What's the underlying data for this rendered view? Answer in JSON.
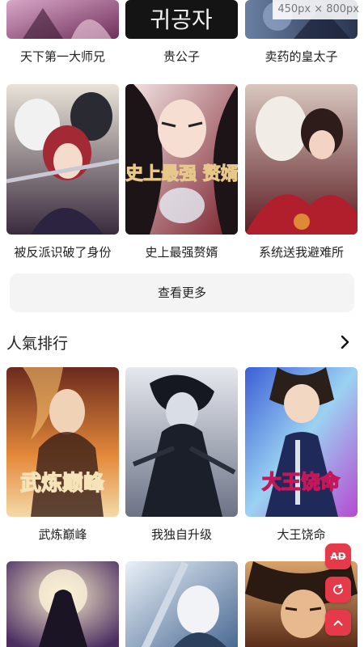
{
  "viewport_badge": "450px × 800px",
  "row_top_titles": [
    "天下第一大师兄",
    "贵公子",
    "卖药的皇太子"
  ],
  "row_top_cover_text": "귀공자",
  "row_second": [
    {
      "title": "被反派识破了身份"
    },
    {
      "title": "史上最强赘婿",
      "cover_text": "史上最强 赘婿"
    },
    {
      "title": "系统送我避难所"
    }
  ],
  "more_button": "查看更多",
  "section": {
    "title": "人氣排行",
    "arrow_icon": "chevron-right-icon"
  },
  "row_popular": [
    {
      "title": "武炼巅峰",
      "cover_text": "武炼巅峰"
    },
    {
      "title": "我独自升级"
    },
    {
      "title": "大王饶命",
      "cover_text": "大王饶命"
    }
  ],
  "floating": {
    "ad_label": "AD",
    "refresh_icon": "refresh-icon",
    "up_icon": "chevron-up-icon"
  },
  "colors": {
    "accent": "#e53a49",
    "more_bg": "#f4f4f4",
    "text": "#222222"
  }
}
